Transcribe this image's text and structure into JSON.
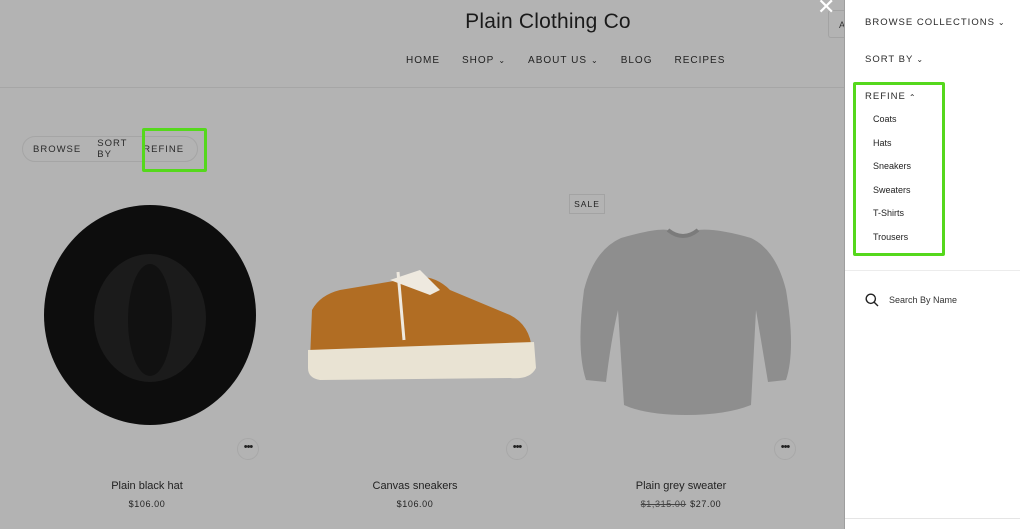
{
  "store": {
    "title": "Plain Clothing Co",
    "header_partial_button": "A",
    "nav": [
      {
        "label": "HOME",
        "has_dropdown": false
      },
      {
        "label": "SHOP",
        "has_dropdown": true
      },
      {
        "label": "ABOUT US",
        "has_dropdown": true
      },
      {
        "label": "BLOG",
        "has_dropdown": false
      },
      {
        "label": "RECIPES",
        "has_dropdown": false
      }
    ],
    "filter_bar": {
      "browse": "BROWSE",
      "sort_by": "SORT BY",
      "refine": "REFINE"
    },
    "products": [
      {
        "name": "Plain black hat",
        "price": "$106.00",
        "original_price": null,
        "sale": false,
        "more_icon": "ellipsis-icon"
      },
      {
        "name": "Canvas sneakers",
        "price": "$106.00",
        "original_price": null,
        "sale": false,
        "more_icon": "ellipsis-icon"
      },
      {
        "name": "Plain grey sweater",
        "price": "$27.00",
        "original_price": "$1,315.00",
        "sale": true,
        "sale_label": "SALE",
        "more_icon": "ellipsis-icon"
      }
    ]
  },
  "overlay": {
    "close_icon": "close-icon",
    "drawer": {
      "browse_collections": "BROWSE COLLECTIONS",
      "sort_by": "SORT BY",
      "refine": "REFINE",
      "refine_options": [
        "Coats",
        "Hats",
        "Sneakers",
        "Sweaters",
        "T-Shirts",
        "Trousers"
      ],
      "search_placeholder": "Search By Name",
      "search_icon": "search-icon"
    }
  },
  "colors": {
    "highlight": "#55d81c",
    "overlay_page": "#b3b3b3",
    "drawer_bg": "#ffffff"
  }
}
